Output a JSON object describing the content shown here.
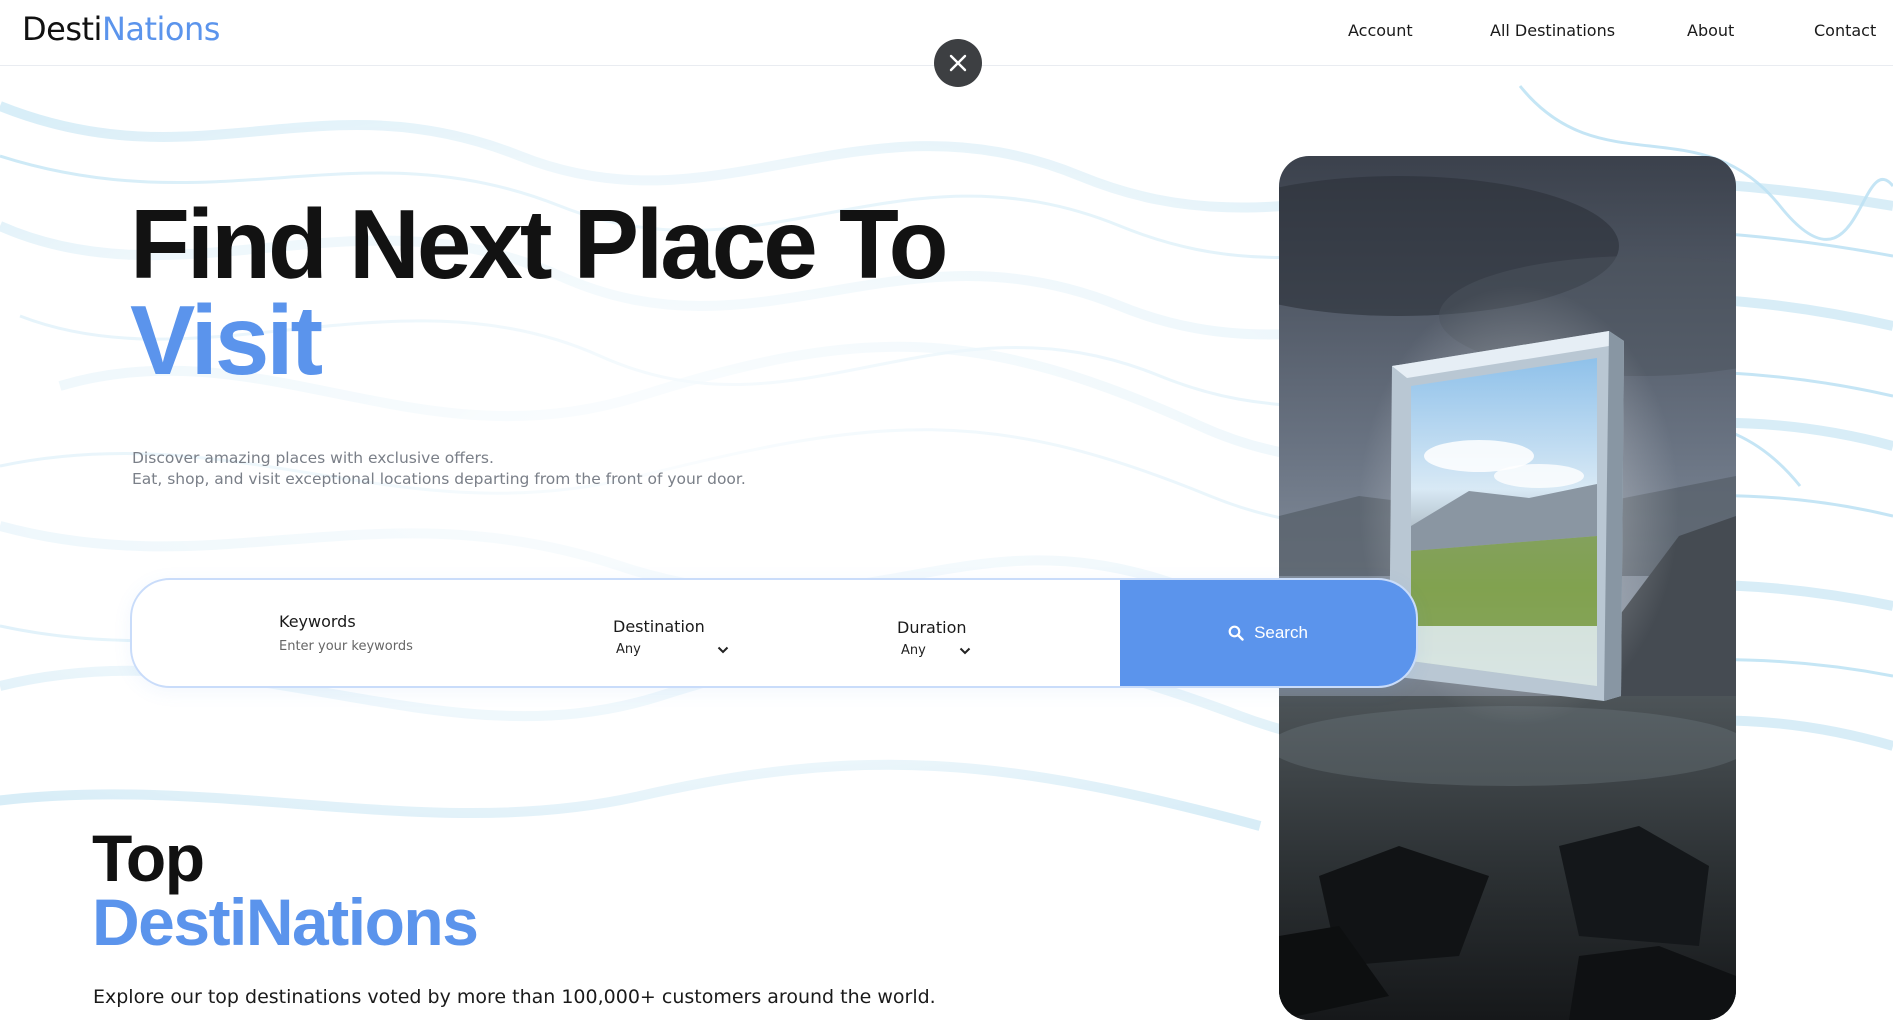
{
  "brand": {
    "logo_part1": "Desti",
    "logo_part2": "Nations",
    "accent_color": "#5b94ec"
  },
  "nav": {
    "items": [
      {
        "label": "Account"
      },
      {
        "label": "All Destinations"
      },
      {
        "label": "About"
      },
      {
        "label": "Contact"
      }
    ]
  },
  "overlay": {
    "close_icon": "close-icon"
  },
  "hero": {
    "title_line1": "Find Next Place To",
    "title_line2": "Visit",
    "subtitle_line1": "Discover amazing places with exclusive offers.",
    "subtitle_line2": "Eat, shop, and visit exceptional locations departing from the front of your door."
  },
  "search": {
    "keywords_label": "Keywords",
    "keywords_placeholder": "Enter your keywords",
    "destination_label": "Destination",
    "destination_value": "Any",
    "duration_label": "Duration",
    "duration_value": "Any",
    "button_label": "Search",
    "button_icon": "search-icon"
  },
  "top_destinations": {
    "title_line1": "Top",
    "title_line2": "DestiNations",
    "subtitle": "Explore our top destinations voted by more than 100,000+ customers around the world."
  }
}
